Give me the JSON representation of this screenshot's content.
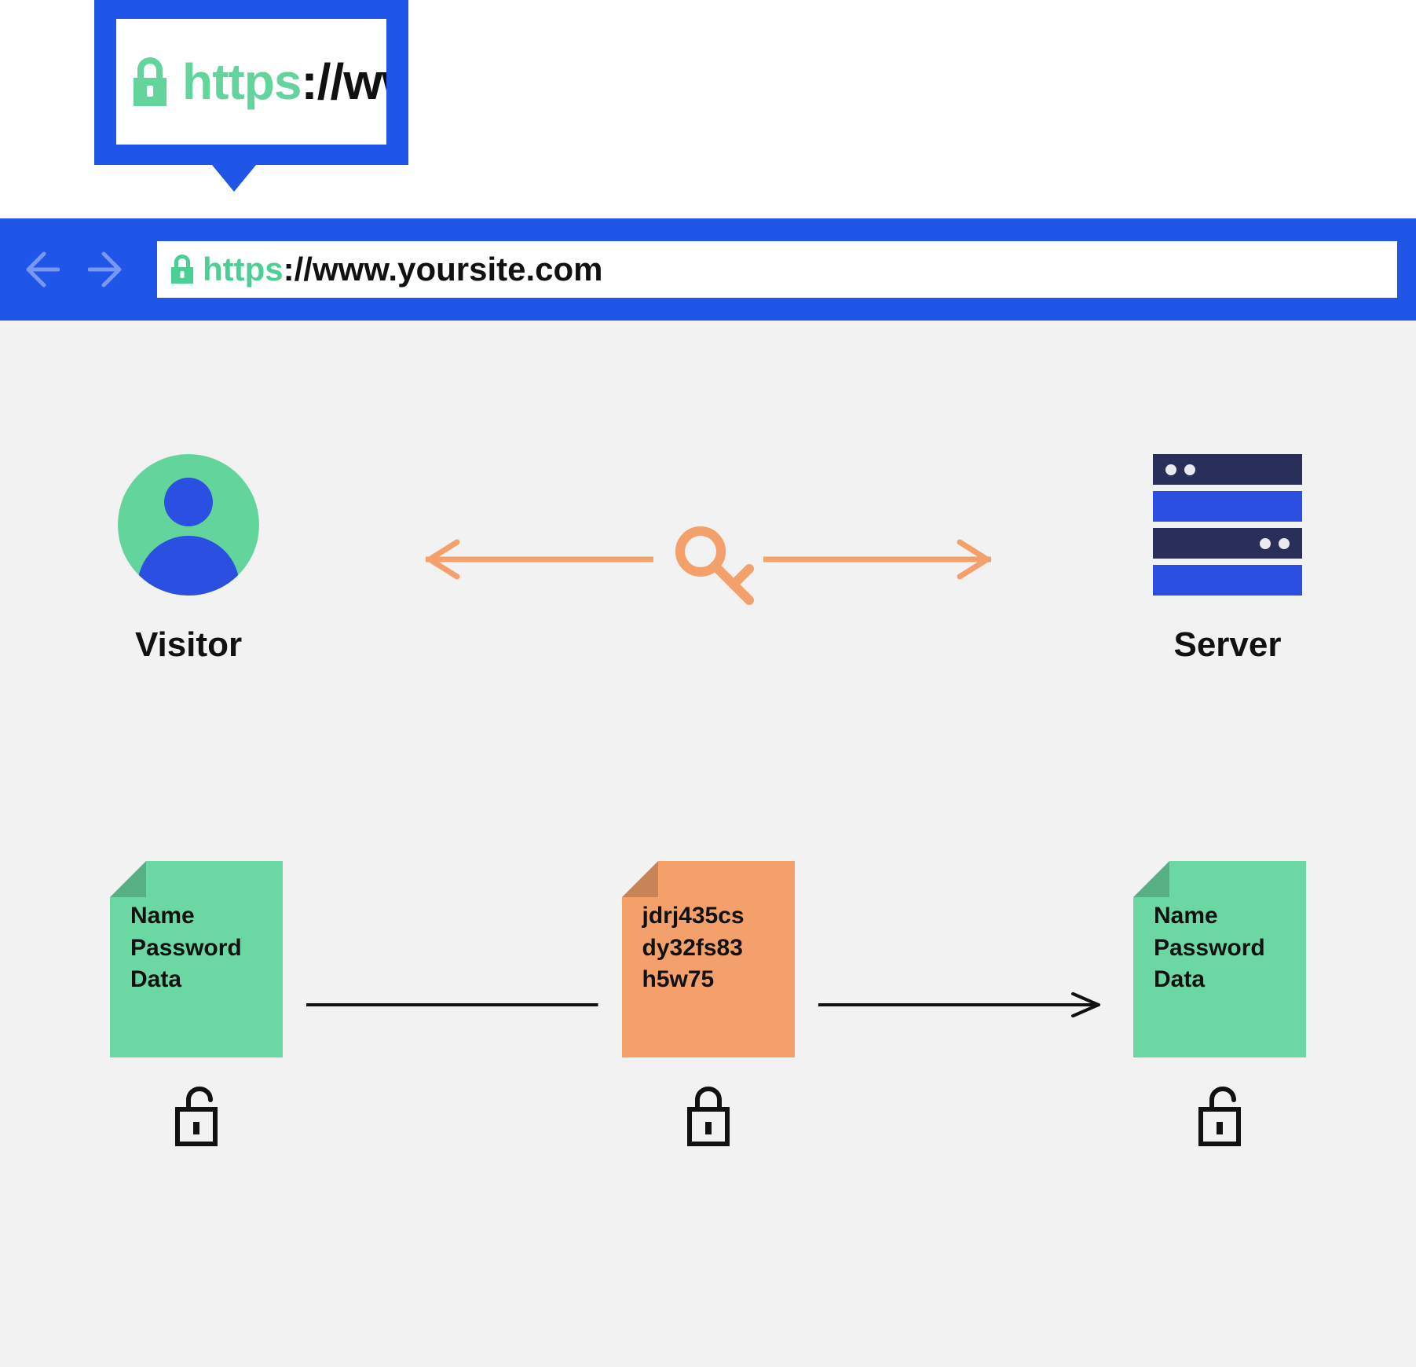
{
  "callout": {
    "scheme": "https",
    "rest": "://ww"
  },
  "address_bar": {
    "scheme": "https",
    "rest": "://www.yoursite.com"
  },
  "endpoints": {
    "visitor_label": "Visitor",
    "server_label": "Server"
  },
  "files": {
    "plain": {
      "line1": "Name",
      "line2": "Password",
      "line3": "Data"
    },
    "cipher": {
      "line1": "jdrj435cs",
      "line2": "dy32fs83",
      "line3": "h5w75"
    },
    "plain2": {
      "line1": "Name",
      "line2": "Password",
      "line3": "Data"
    }
  },
  "colors": {
    "brand_blue": "#2056e8",
    "accent_green": "#63d49c",
    "accent_orange": "#f4a06a",
    "dark_navy": "#2a2f5a"
  }
}
